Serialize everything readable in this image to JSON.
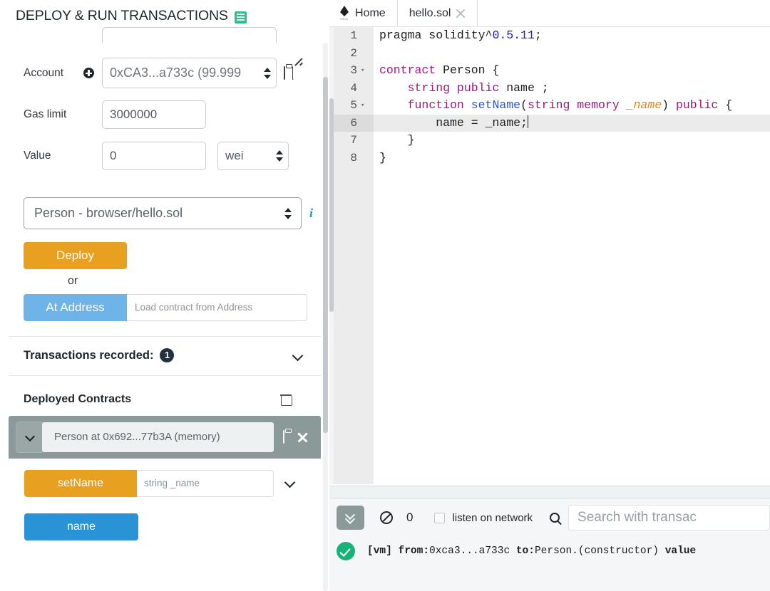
{
  "sidebar": {
    "title": "DEPLOY & RUN TRANSACTIONS",
    "title_icon": "book-icon",
    "account": {
      "label": "Account",
      "add_icon": "plus-circle-icon",
      "value": "0xCA3...a733c (99.999",
      "copy_icon": "clipboard-icon",
      "edit_icon": "edit-pencil-icon"
    },
    "gas_limit": {
      "label": "Gas limit",
      "value": "3000000"
    },
    "value_field": {
      "label": "Value",
      "value": "0",
      "unit": "wei"
    },
    "contract_select": {
      "value": "Person - browser/hello.sol",
      "info_icon": "info-icon",
      "info_glyph": "i"
    },
    "deploy_button": "Deploy",
    "or_text": "or",
    "at_address_button": "At Address",
    "at_address_placeholder": "Load contract from Address",
    "transactions_recorded": {
      "label": "Transactions recorded:",
      "count": "1",
      "chevron_icon": "chevron-down-icon"
    },
    "deployed_contracts": {
      "title": "Deployed Contracts",
      "trash_icon": "trash-icon",
      "card": {
        "toggle_icon": "chevron-down-icon",
        "address_label": "Person at 0x692...77b3A (memory)",
        "copy_icon": "clipboard-icon",
        "close_icon": "close-x-icon",
        "functions": [
          {
            "name": "setName",
            "kind": "orange",
            "input_placeholder": "string _name",
            "expand_icon": "chevron-down-icon"
          },
          {
            "name": "name",
            "kind": "blue"
          }
        ]
      }
    }
  },
  "editor": {
    "tabs": [
      {
        "label": "Home",
        "icon": "remix-logo-icon",
        "wordmark": "remix",
        "active": false,
        "closable": false
      },
      {
        "label": "hello.sol",
        "active": true,
        "closable": true,
        "close_icon": "close-x-icon"
      }
    ],
    "active_line": 6,
    "lines": [
      {
        "n": "1",
        "fold": "",
        "tokens": [
          {
            "t": "pragma solidity^",
            "c": "k-txt"
          },
          {
            "t": "0.5.11",
            "c": "k-num"
          },
          {
            "t": ";",
            "c": "k-txt"
          }
        ]
      },
      {
        "n": "2",
        "fold": "",
        "tokens": []
      },
      {
        "n": "3",
        "fold": "▾",
        "tokens": [
          {
            "t": "contract",
            "c": "k-kw"
          },
          {
            "t": " Person {",
            "c": "k-txt"
          }
        ]
      },
      {
        "n": "4",
        "fold": "",
        "tokens": [
          {
            "t": "    ",
            "c": "k-txt"
          },
          {
            "t": "string public",
            "c": "k-kw"
          },
          {
            "t": " name ;",
            "c": "k-txt"
          }
        ]
      },
      {
        "n": "5",
        "fold": "▾",
        "tokens": [
          {
            "t": "    ",
            "c": "k-txt"
          },
          {
            "t": "function",
            "c": "k-kw"
          },
          {
            "t": " ",
            "c": "k-txt"
          },
          {
            "t": "setName",
            "c": "k-fn"
          },
          {
            "t": "(",
            "c": "k-txt"
          },
          {
            "t": "string memory",
            "c": "k-kw"
          },
          {
            "t": " ",
            "c": "k-txt"
          },
          {
            "t": "_name",
            "c": "k-var"
          },
          {
            "t": ") ",
            "c": "k-txt"
          },
          {
            "t": "public",
            "c": "k-kw"
          },
          {
            "t": " {",
            "c": "k-txt"
          }
        ]
      },
      {
        "n": "6",
        "fold": "",
        "tokens": [
          {
            "t": "        name = _name;",
            "c": "k-txt"
          }
        ]
      },
      {
        "n": "7",
        "fold": "",
        "tokens": [
          {
            "t": "    }",
            "c": "k-txt"
          }
        ]
      },
      {
        "n": "8",
        "fold": "",
        "tokens": [
          {
            "t": "}",
            "c": "k-txt"
          }
        ]
      }
    ]
  },
  "terminal": {
    "expand_icon": "chevron-double-down-icon",
    "clear_icon": "ban-circle-icon",
    "count": "0",
    "listen_checkbox_checked": false,
    "listen_label": "listen on network",
    "search_icon": "search-icon",
    "search_placeholder": "Search with transac",
    "log": {
      "status_icon": "check-circle-icon",
      "segments": [
        {
          "t": "[vm]",
          "b": true
        },
        {
          "t": "  ",
          "b": false
        },
        {
          "t": "from:",
          "b": true
        },
        {
          "t": "0xca3...a733c ",
          "b": false
        },
        {
          "t": "to:",
          "b": true
        },
        {
          "t": "Person.(constructor) ",
          "b": false
        },
        {
          "t": "value",
          "b": true
        }
      ]
    }
  },
  "colors": {
    "orange": "#e8a020",
    "blue_light": "#6fb4e8",
    "blue": "#2a93d5",
    "gray_header": "#8b9a99",
    "green": "#16b378",
    "badge_dark": "#22303f"
  }
}
